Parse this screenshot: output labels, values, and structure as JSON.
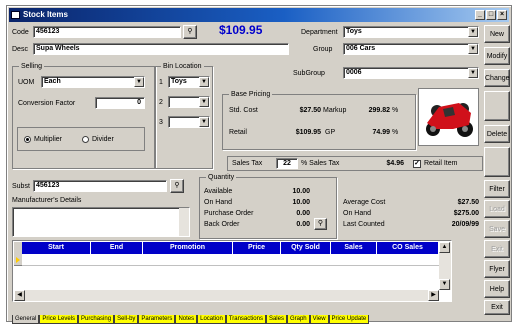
{
  "window": {
    "title": "Stock Items"
  },
  "header": {
    "code_label": "Code",
    "code_value": "456123",
    "price": "$109.95",
    "department_label": "Department",
    "department_value": "Toys",
    "desc_label": "Desc",
    "desc_value": "Supa Wheels",
    "group_label": "Group",
    "group_value": "006 Cars",
    "subgroup_label": "SubGroup",
    "subgroup_value": "0006"
  },
  "selling": {
    "title": "Selling",
    "uom_label": "UOM",
    "uom_value": "Each",
    "conversion_label": "Conversion Factor",
    "conversion_value": "0",
    "multiplier_label": "Multiplier",
    "divider_label": "Divider"
  },
  "bin": {
    "title": "Bin Location",
    "rows": [
      {
        "n": "1",
        "value": "Toys"
      },
      {
        "n": "2",
        "value": ""
      },
      {
        "n": "3",
        "value": ""
      }
    ]
  },
  "pricing": {
    "title": "Base Pricing",
    "std_cost_label": "Std. Cost",
    "std_cost": "$27.50",
    "markup_label": "Markup",
    "markup": "299.82",
    "retail_label": "Retail",
    "retail": "$109.95",
    "gp_label": "GP",
    "gp": "74.99",
    "pct": "%",
    "sales_tax_label": "Sales Tax",
    "sales_tax": "22",
    "sales_tax_pct_label": "% Sales Tax",
    "sales_tax_amount": "$4.96",
    "retail_item_label": "Retail Item"
  },
  "subst": {
    "label": "Subst",
    "value": "456123",
    "manufacturer_label": "Manufacturer's Details"
  },
  "quantity": {
    "title": "Quantity",
    "available_label": "Available",
    "available": "10.00",
    "onhand_label": "On Hand",
    "onhand": "10.00",
    "po_label": "Purchase Order",
    "po": "0.00",
    "bo_label": "Back Order",
    "bo": "0.00",
    "avg_cost_label": "Average Cost",
    "avg_cost": "$27.50",
    "onhand_value_label": "On Hand",
    "onhand_value": "$275.00",
    "last_counted_label": "Last Counted",
    "last_counted": "20/09/99"
  },
  "grid": {
    "columns": [
      "Start",
      "End",
      "Promotion",
      "Price",
      "Qty Sold",
      "Sales",
      "CO Sales"
    ]
  },
  "buttons": [
    "New",
    "Modify",
    "Change",
    "",
    "Delete",
    "",
    "Filter ▼",
    "Load",
    "Save",
    "Exit",
    "Flyer",
    "Help",
    "Exit"
  ],
  "tabs": [
    "General",
    "Price Levels",
    "Purchasing",
    "Sell-by",
    "Parameters",
    "Notes",
    "Location",
    "Transactions",
    "Sales",
    "Graph",
    "View",
    "Price Update"
  ],
  "colors": {
    "title_start": "#0a246a",
    "grid_header": "#0000c8",
    "price": "#0000cc",
    "tabs": "#ffff00"
  }
}
